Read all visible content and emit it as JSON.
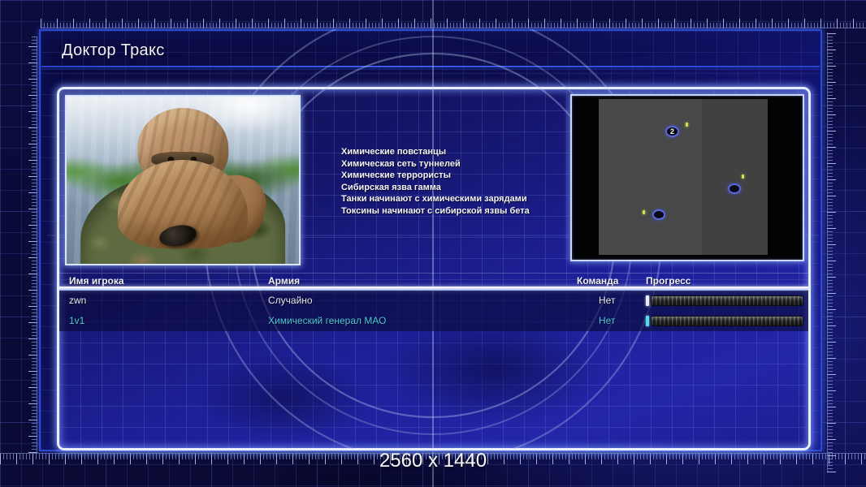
{
  "screen": {
    "title": "Доктор Тракс",
    "resolution_label": "2560 x 1440"
  },
  "profile": {
    "traits": [
      "Химические повстанцы",
      "Химическая сеть туннелей",
      "Химические террористы",
      "Сибирская язва гамма",
      "Танки начинают с химическими зарядами",
      "Токсины начинают с сибирской язвы бета"
    ]
  },
  "minimap": {
    "markers": [
      {
        "label": "2"
      },
      {
        "label": ""
      },
      {
        "label": ""
      }
    ],
    "marker_ring_color": "#5a66dc",
    "resource_dot_color": "#d4e455"
  },
  "players": {
    "headers": {
      "name": "Имя игрока",
      "army": "Армия",
      "team": "Команда",
      "progress": "Прогресс"
    },
    "rows": [
      {
        "name": "zwn",
        "army": "Случайно",
        "team": "Нет",
        "progress_percent": 2
      },
      {
        "name": "1v1",
        "army": "Химический генерал МАО",
        "team": "Нет",
        "progress_percent": 2
      }
    ]
  },
  "colors": {
    "accent_cyan": "#4bc9da",
    "panel_blue": "#2023a0",
    "frame_border_blue": "#2c4ad4",
    "glow_white": "#e9efff"
  }
}
